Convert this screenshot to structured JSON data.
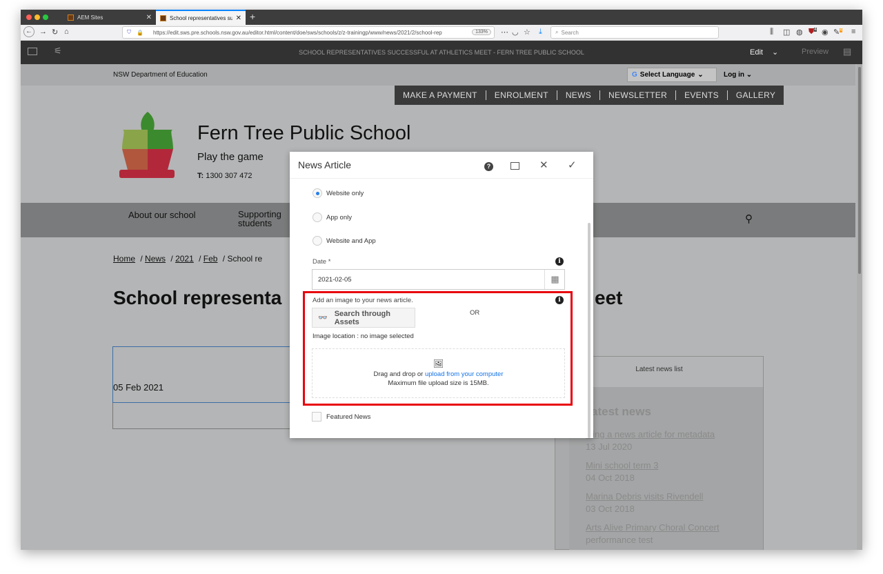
{
  "browser": {
    "tabs": [
      {
        "label": "AEM Sites",
        "active": false
      },
      {
        "label": "School representatives success",
        "active": true
      }
    ],
    "url": "https://edit.sws.pre.schools.nsw.gov.au/editor.html/content/doe/sws/schools/z/z-trainingp/www/news/2021/2/school-rep",
    "zoom": "133%",
    "search_placeholder": "Search",
    "badges": [
      "4",
      "4"
    ]
  },
  "aem": {
    "page_title": "SCHOOL REPRESENTATIVES SUCCESSFUL AT ATHLETICS MEET - FERN TREE PUBLIC SCHOOL",
    "mode": "Edit",
    "preview": "Preview"
  },
  "site": {
    "department": "NSW Department of Education",
    "select_language": "Select Language",
    "login": "Log in",
    "menu": [
      "MAKE A PAYMENT",
      "ENROLMENT",
      "NEWS",
      "NEWSLETTER",
      "EVENTS",
      "GALLERY"
    ],
    "school_name": "Fern Tree Public School",
    "tagline": "Play the game",
    "phone_label": "T:",
    "phone": "1300 307 472",
    "nav": [
      "About our school",
      "Supporting students"
    ],
    "breadcrumb": [
      "Home",
      "News",
      "2021",
      "Feb",
      "School re"
    ],
    "heading_left": "School representa",
    "heading_right": "eet",
    "article_date": "05 Feb 2021",
    "latest_list_label": "Latest news list",
    "latest_heading": "atest news",
    "latest": [
      {
        "title": "sting a news article for metadata",
        "date": "13 Jul 2020"
      },
      {
        "title": "Mini school term 3",
        "date": "04 Oct 2018"
      },
      {
        "title": "Marina Debris visits Rivendell",
        "date": "03 Oct 2018"
      },
      {
        "title": "Arts Alive Primary Choral Concert",
        "date": "performance test"
      }
    ]
  },
  "dialog": {
    "title": "News Article",
    "radios": [
      {
        "label": "Website only",
        "checked": true
      },
      {
        "label": "App only",
        "checked": false
      },
      {
        "label": "Website and App",
        "checked": false
      }
    ],
    "date_label": "Date *",
    "date_value": "2021-02-05",
    "image_label": "Add an image to your news article.",
    "search_assets": "Search through Assets",
    "or": "OR",
    "image_location": "Image location : no image selected",
    "drag_text": "Drag and drop or ",
    "upload_link": "upload from your computer",
    "max_size": "Maximum file upload size is 15MB.",
    "featured": "Featured News",
    "featured_checked": false
  },
  "colors": {
    "highlight": "#e8000b",
    "accent": "#2680eb",
    "link": "#1473e6"
  }
}
